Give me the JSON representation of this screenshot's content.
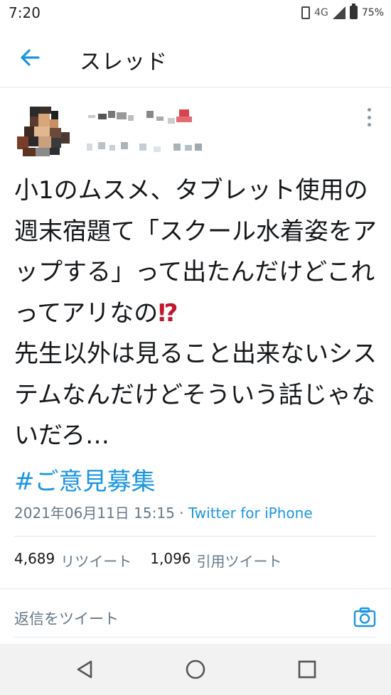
{
  "status_bar": {
    "time": "7:20",
    "network": "4G",
    "battery": "75%"
  },
  "header": {
    "title": "スレッド",
    "back_icon": "arrow-left-icon"
  },
  "tweet": {
    "text_lines": [
      "小1のムスメ、タブレット使用の",
      "週末宿題て「スクール水着姿をア",
      "ップする」って出たんだけどこれ",
      "ってアリなの",
      "先生以外は見ること出来ないシス",
      "テムなんだけどそういう話じゃな",
      "いだろ…"
    ],
    "emoji": "⁉",
    "hashtag": "#ご意見募集",
    "timestamp": "2021年06月11日 15:15",
    "separator": " · ",
    "client": "Twitter for iPhone"
  },
  "stats": {
    "retweets_count": "4,689",
    "retweets_label": "リツイート",
    "quotes_count": "1,096",
    "quotes_label": "引用ツイート"
  },
  "reply": {
    "placeholder": "返信をツイート"
  },
  "colors": {
    "accent": "#1b95e0",
    "text": "#14171a",
    "muted": "#657786",
    "border": "#e1e8ed"
  }
}
